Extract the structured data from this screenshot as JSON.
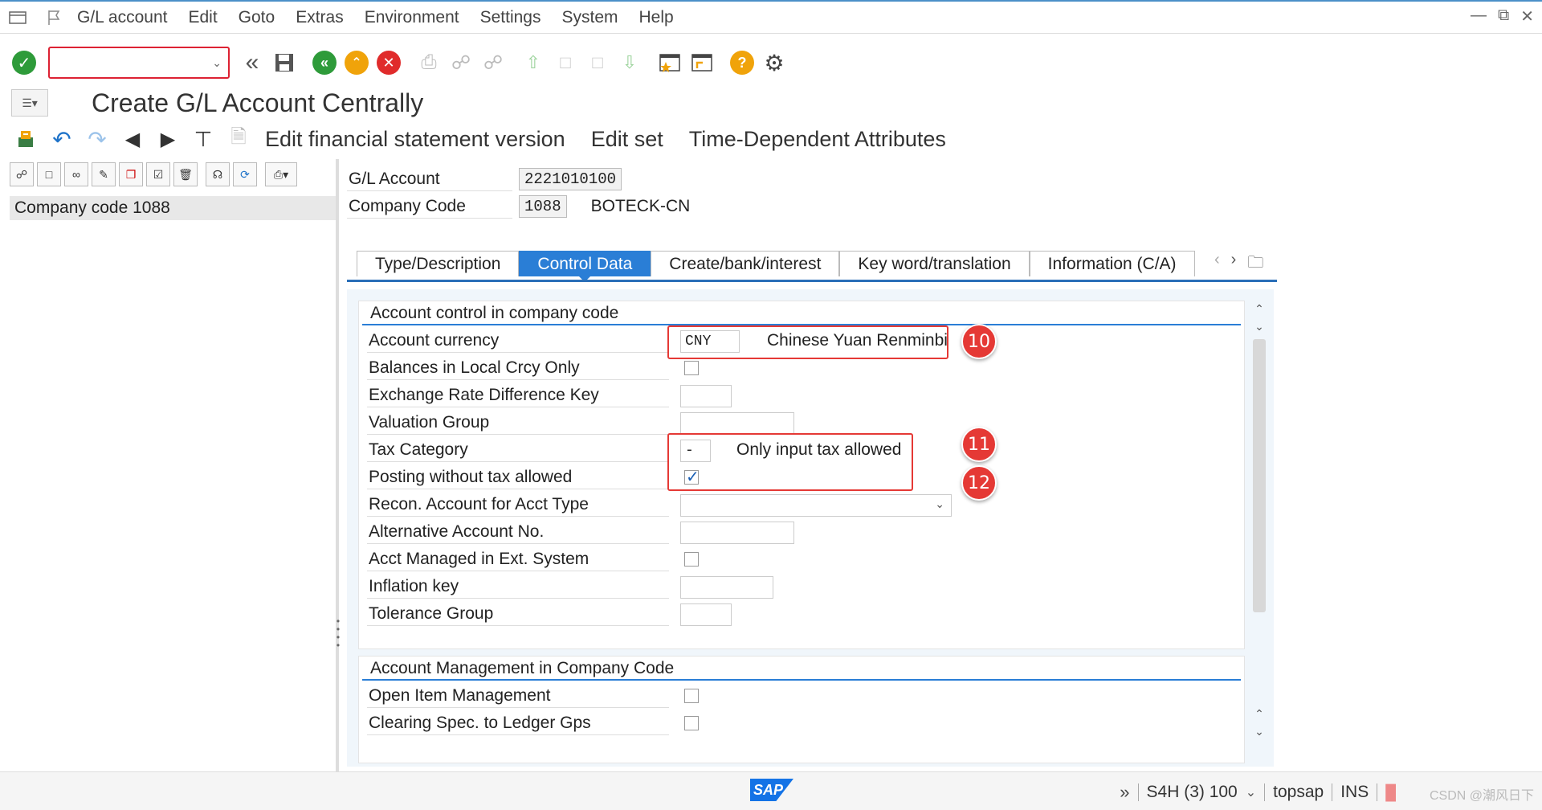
{
  "menu": {
    "items": [
      "G/L account",
      "Edit",
      "Goto",
      "Extras",
      "Environment",
      "Settings",
      "System",
      "Help"
    ]
  },
  "toolbar": {
    "command_value": ""
  },
  "title": "Create G/L Account Centrally",
  "app_toolbar": {
    "buttons": [
      "Edit financial statement version",
      "Edit set",
      "Time-Dependent Attributes"
    ]
  },
  "left_pane": {
    "selected_item": "Company code 1088"
  },
  "header": {
    "gl_account_label": "G/L Account",
    "gl_account_value": "2221010100",
    "company_code_label": "Company Code",
    "company_code_value": "1088",
    "company_code_name": "BOTECK-CN"
  },
  "tabs": [
    "Type/Description",
    "Control Data",
    "Create/bank/interest",
    "Key word/translation",
    "Information (C/A)"
  ],
  "active_tab": "Control Data",
  "group1": {
    "title": "Account control in company code",
    "fields": {
      "account_currency_label": "Account currency",
      "account_currency_value": "CNY",
      "account_currency_text": "Chinese Yuan Renminbi",
      "balances_local_label": "Balances in Local Crcy Only",
      "balances_local_checked": false,
      "exchange_rate_label": "Exchange Rate Difference Key",
      "exchange_rate_value": "",
      "valuation_group_label": "Valuation Group",
      "valuation_group_value": "",
      "tax_category_label": "Tax Category",
      "tax_category_value": "-",
      "tax_category_text": "Only input tax allowed",
      "posting_without_tax_label": "Posting without tax allowed",
      "posting_without_tax_checked": true,
      "recon_account_label": "Recon. Account for Acct Type",
      "recon_account_value": "",
      "alt_account_label": "Alternative Account No.",
      "alt_account_value": "",
      "ext_system_label": "Acct Managed in Ext. System",
      "ext_system_checked": false,
      "inflation_key_label": "Inflation key",
      "inflation_key_value": "",
      "tolerance_group_label": "Tolerance Group",
      "tolerance_group_value": ""
    }
  },
  "group2": {
    "title": "Account Management in Company Code",
    "fields": {
      "open_item_label": "Open Item Management",
      "open_item_checked": false,
      "clearing_spec_label": "Clearing Spec. to Ledger Gps",
      "clearing_spec_checked": false
    }
  },
  "annotations": {
    "badge_10": "10",
    "badge_11": "11",
    "badge_12": "12",
    "color": "#e53935"
  },
  "status": {
    "logo": "SAP",
    "system": "S4H (3) 100",
    "user": "topsap",
    "mode": "INS",
    "watermark": "CSDN @潮风日下"
  },
  "colors": {
    "accent": "#2a7ed6",
    "annotation_red": "#e53935"
  }
}
